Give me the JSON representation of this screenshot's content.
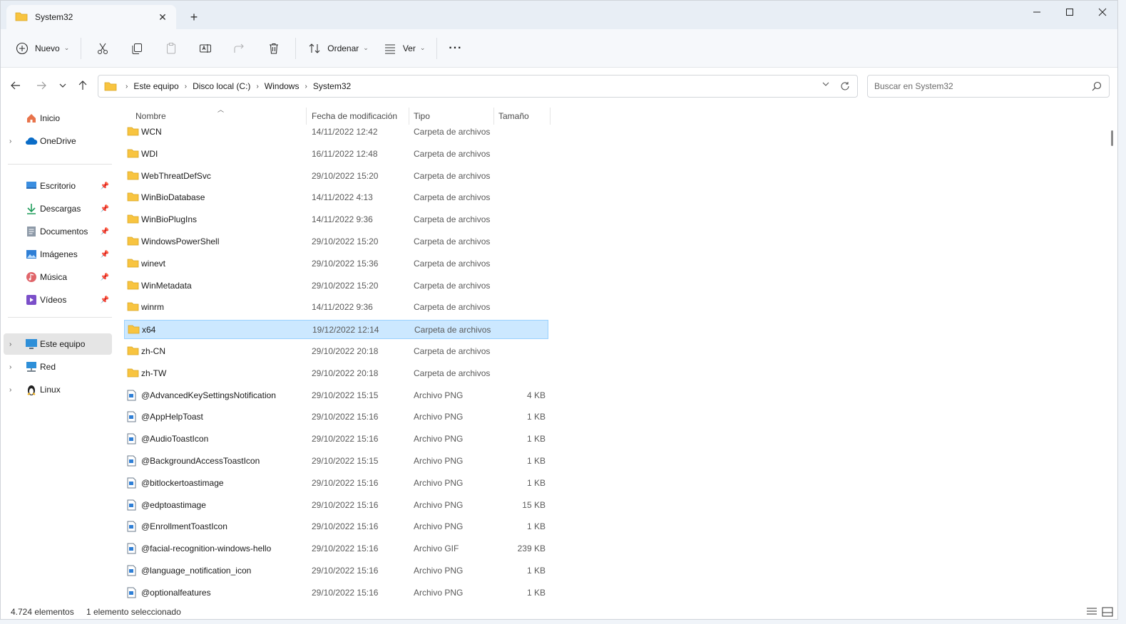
{
  "window": {
    "tab_title": "System32",
    "new_tab": "+",
    "close_tab": "✕"
  },
  "toolbar": {
    "new_label": "Nuevo",
    "sort_label": "Ordenar",
    "view_label": "Ver",
    "more_label": "···"
  },
  "address": {
    "crumbs": [
      "Este equipo",
      "Disco local (C:)",
      "Windows",
      "System32"
    ]
  },
  "search": {
    "placeholder": "Buscar en System32"
  },
  "sidebar": {
    "items": [
      {
        "label": "Inicio",
        "icon": "home-icon"
      },
      {
        "label": "OneDrive",
        "icon": "onedrive-icon"
      },
      {
        "label": "Escritorio",
        "icon": "desktop-icon"
      },
      {
        "label": "Descargas",
        "icon": "downloads-icon"
      },
      {
        "label": "Documentos",
        "icon": "documents-icon"
      },
      {
        "label": "Imágenes",
        "icon": "pictures-icon"
      },
      {
        "label": "Música",
        "icon": "music-icon"
      },
      {
        "label": "Vídeos",
        "icon": "videos-icon"
      },
      {
        "label": "Este equipo",
        "icon": "this-pc-icon"
      },
      {
        "label": "Red",
        "icon": "network-icon"
      },
      {
        "label": "Linux",
        "icon": "linux-icon"
      }
    ]
  },
  "columns": {
    "name": "Nombre",
    "date": "Fecha de modificación",
    "type": "Tipo",
    "size": "Tamaño"
  },
  "files": [
    {
      "name": "WCN",
      "date": "14/11/2022 12:42",
      "type": "Carpeta de archivos",
      "size": "",
      "kind": "folder"
    },
    {
      "name": "WDI",
      "date": "16/11/2022 12:48",
      "type": "Carpeta de archivos",
      "size": "",
      "kind": "folder"
    },
    {
      "name": "WebThreatDefSvc",
      "date": "29/10/2022 15:20",
      "type": "Carpeta de archivos",
      "size": "",
      "kind": "folder"
    },
    {
      "name": "WinBioDatabase",
      "date": "14/11/2022 4:13",
      "type": "Carpeta de archivos",
      "size": "",
      "kind": "folder"
    },
    {
      "name": "WinBioPlugIns",
      "date": "14/11/2022 9:36",
      "type": "Carpeta de archivos",
      "size": "",
      "kind": "folder"
    },
    {
      "name": "WindowsPowerShell",
      "date": "29/10/2022 15:20",
      "type": "Carpeta de archivos",
      "size": "",
      "kind": "folder"
    },
    {
      "name": "winevt",
      "date": "29/10/2022 15:36",
      "type": "Carpeta de archivos",
      "size": "",
      "kind": "folder"
    },
    {
      "name": "WinMetadata",
      "date": "29/10/2022 15:20",
      "type": "Carpeta de archivos",
      "size": "",
      "kind": "folder"
    },
    {
      "name": "winrm",
      "date": "14/11/2022 9:36",
      "type": "Carpeta de archivos",
      "size": "",
      "kind": "folder"
    },
    {
      "name": "x64",
      "date": "19/12/2022 12:14",
      "type": "Carpeta de archivos",
      "size": "",
      "kind": "folder",
      "selected": true
    },
    {
      "name": "zh-CN",
      "date": "29/10/2022 20:18",
      "type": "Carpeta de archivos",
      "size": "",
      "kind": "folder"
    },
    {
      "name": "zh-TW",
      "date": "29/10/2022 20:18",
      "type": "Carpeta de archivos",
      "size": "",
      "kind": "folder"
    },
    {
      "name": "@AdvancedKeySettingsNotification",
      "date": "29/10/2022 15:15",
      "type": "Archivo PNG",
      "size": "4 KB",
      "kind": "image"
    },
    {
      "name": "@AppHelpToast",
      "date": "29/10/2022 15:16",
      "type": "Archivo PNG",
      "size": "1 KB",
      "kind": "image"
    },
    {
      "name": "@AudioToastIcon",
      "date": "29/10/2022 15:16",
      "type": "Archivo PNG",
      "size": "1 KB",
      "kind": "image"
    },
    {
      "name": "@BackgroundAccessToastIcon",
      "date": "29/10/2022 15:15",
      "type": "Archivo PNG",
      "size": "1 KB",
      "kind": "image"
    },
    {
      "name": "@bitlockertoastimage",
      "date": "29/10/2022 15:16",
      "type": "Archivo PNG",
      "size": "1 KB",
      "kind": "image"
    },
    {
      "name": "@edptoastimage",
      "date": "29/10/2022 15:16",
      "type": "Archivo PNG",
      "size": "15 KB",
      "kind": "image"
    },
    {
      "name": "@EnrollmentToastIcon",
      "date": "29/10/2022 15:16",
      "type": "Archivo PNG",
      "size": "1 KB",
      "kind": "image"
    },
    {
      "name": "@facial-recognition-windows-hello",
      "date": "29/10/2022 15:16",
      "type": "Archivo GIF",
      "size": "239 KB",
      "kind": "image"
    },
    {
      "name": "@language_notification_icon",
      "date": "29/10/2022 15:16",
      "type": "Archivo PNG",
      "size": "1 KB",
      "kind": "image"
    },
    {
      "name": "@optionalfeatures",
      "date": "29/10/2022 15:16",
      "type": "Archivo PNG",
      "size": "1 KB",
      "kind": "image"
    }
  ],
  "status": {
    "count": "4.724 elementos",
    "selection": "1 elemento seleccionado"
  },
  "colors": {
    "accent": "#0067c0",
    "folder": "#f8c440",
    "selection_bg": "#cce8ff",
    "selection_border": "#99d1ff"
  }
}
